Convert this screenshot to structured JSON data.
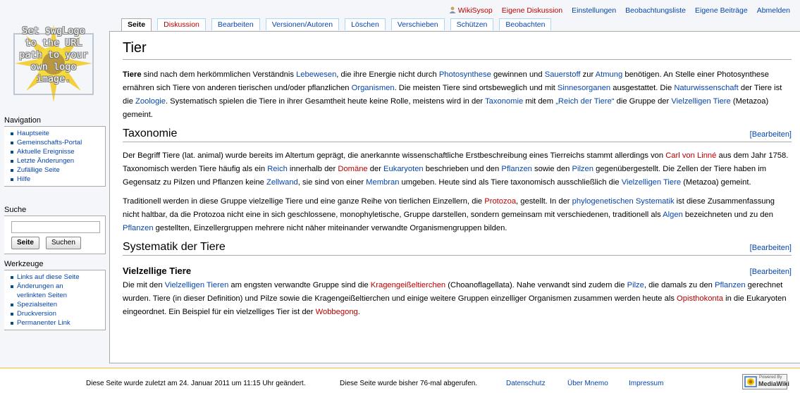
{
  "personal_tools": {
    "user": "WikiSysop",
    "talk": "Eigene Diskussion",
    "preferences": "Einstellungen",
    "watchlist": "Beobachtungsliste",
    "contributions": "Eigene Beiträge",
    "logout": "Abmelden"
  },
  "tabs": {
    "page": "Seite",
    "discussion": "Diskussion",
    "edit": "Bearbeiten",
    "history": "Versionen/Autoren",
    "delete": "Löschen",
    "move": "Verschieben",
    "protect": "Schützen",
    "watch": "Beobachten"
  },
  "logo": {
    "l1": "Set $wgLogo",
    "l2": "to the URL",
    "l3": "path to your",
    "l4": "own logo",
    "l5": "image."
  },
  "navigation": {
    "title": "Navigation",
    "items": [
      "Hauptseite",
      "Gemeinschafts-Portal",
      "Aktuelle Ereignisse",
      "Letzte Änderungen",
      "Zufällige Seite",
      "Hilfe"
    ]
  },
  "search": {
    "title": "Suche",
    "value": "",
    "go": "Seite",
    "search": "Suchen"
  },
  "toolbox": {
    "title": "Werkzeuge",
    "items": [
      "Links auf diese Seite",
      "Änderungen an",
      "verlinkten Seiten",
      "Spezialseiten",
      "Druckversion",
      "Permanenter Link"
    ]
  },
  "article": {
    "title": "Tier",
    "edit_label": "[Bearbeiten]",
    "p1": {
      "t0": "Tiere",
      "t1": " sind nach dem herkömmlichen Verständnis ",
      "l1": "Lebewesen",
      "t2": ", die ihre Energie nicht durch ",
      "l2": "Photosynthese",
      "t3": " gewinnen und ",
      "l3": "Sauerstoff",
      "t4": " zur ",
      "l4": "Atmung",
      "t5": " benötigen. An Stelle einer Photosynthese ernähren sich Tiere von anderen tierischen und/oder pflanzlichen ",
      "l5": "Organismen",
      "t6": ". Die meisten Tiere sind ortsbeweglich und mit ",
      "l6": "Sinnesorganen",
      "t7": " ausgestattet. Die ",
      "l7": "Naturwissenschaft",
      "t8": " der Tiere ist die ",
      "l8": "Zoologie",
      "t9": ". Systematisch spielen die Tiere in ihrer Gesamtheit heute keine Rolle, meistens wird in der ",
      "l9": "Taxonomie",
      "t10": " mit dem ",
      "l10": "„Reich der Tiere“",
      "t11": " die Gruppe der ",
      "l11": "Vielzelligen Tiere",
      "t12": " (Metazoa) gemeint."
    },
    "h_tax": "Taxonomie",
    "p2": {
      "t1": "Der Begriff Tiere (lat. animal) wurde bereits im Altertum geprägt, die anerkannte wissenschaftliche Erstbeschreibung eines Tierreichs stammt allerdings von ",
      "r1": "Carl von Linné",
      "t2": " aus dem Jahr 1758. Taxonomisch werden Tiere häufig als ein ",
      "l1": "Reich",
      "t3": " innerhalb der ",
      "r2": "Domäne",
      "t4": " der ",
      "l2": "Eukaryoten",
      "t5": " beschrieben und den ",
      "l3": "Pflanzen",
      "t6": " sowie den ",
      "l4": "Pilzen",
      "t7": " gegenübergestellt. Die Zellen der Tiere haben im Gegensatz zu Pilzen und Pflanzen keine ",
      "l5": "Zellwand",
      "t8": ", sie sind von einer ",
      "l6": "Membran",
      "t9": " umgeben. Heute sind als Tiere taxonomisch ausschließlich die ",
      "l7": "Vielzelligen Tiere",
      "t10": " (Metazoa) gemeint."
    },
    "p3": {
      "t1": "Traditionell werden in diese Gruppe vielzellige Tiere und eine ganze Reihe von tierlichen Einzellern, die ",
      "r1": "Protozoa",
      "t2": ", gestellt. In der ",
      "l1": "phylogenetischen Systematik",
      "t3": " ist diese Zusammenfassung nicht haltbar, da die Protozoa nicht eine in sich geschlossene, monophyletische, Gruppe darstellen, sondern gemeinsam mit verschiedenen, traditionell als ",
      "l2": "Algen",
      "t4": " bezeichneten und zu den ",
      "l3": "Pflanzen",
      "t5": " gestellten, Einzellergruppen mehrere nicht näher miteinander verwandte Organismengruppen bilden."
    },
    "h_sys": "Systematik der Tiere",
    "h_viel": "Vielzellige Tiere",
    "p4": {
      "t1": "Die mit den ",
      "l1": "Vielzelligen Tieren",
      "t2": " am engsten verwandte Gruppe sind die ",
      "r1": "Kragengeißeltierchen",
      "t3": " (Choanoflagellata). Nahe verwandt sind zudem die ",
      "l2": "Pilze",
      "t4": ", die damals zu den ",
      "l3": "Pflanzen",
      "t5": " gerechnet wurden. Tiere (in dieser Definition) und Pilze sowie die Kragengeißeltierchen und einige weitere Gruppen einzelliger Organismen zusammen werden heute als ",
      "r2": "Opisthokonta",
      "t6": " in die Eukaryoten eingeordnet. Ein Beispiel für ein vielzelliges Tier ist der ",
      "r3": "Wobbegong",
      "t7": "."
    }
  },
  "footer": {
    "lastmod": "Diese Seite wurde zuletzt am 24. Januar 2011 um 11:15 Uhr geändert.",
    "viewcount": "Diese Seite wurde bisher 76-mal abgerufen.",
    "privacy": "Datenschutz",
    "about": "Über Mnemo",
    "disclaimer": "Impressum",
    "powered_small": "Powered By",
    "powered_big": "MediaWiki"
  },
  "colors": {
    "link": "#0645ad",
    "redlink": "#ba0000",
    "footer_border": "#fabd23"
  }
}
